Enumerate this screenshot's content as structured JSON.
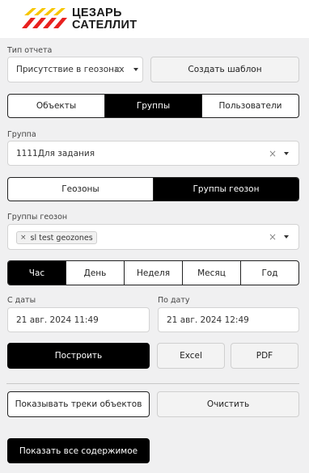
{
  "header": {
    "logo_line1": "ЦЕЗАРЬ",
    "logo_line2": "САТЕЛЛИТ"
  },
  "report_type": {
    "label": "Тип отчета",
    "value": "Присутствие в геозонах",
    "create_template_label": "Создать шаблон"
  },
  "entity_tabs": [
    "Объекты",
    "Группы",
    "Пользователи"
  ],
  "group": {
    "label": "Группа",
    "value": "1111Для задания"
  },
  "zone_tabs": [
    "Геозоны",
    "Группы геозон"
  ],
  "geozone_groups": {
    "label": "Группы геозон",
    "chip": "sl test geozones"
  },
  "period_tabs": [
    "Час",
    "День",
    "Неделя",
    "Месяц",
    "Год"
  ],
  "date_from": {
    "label": "С даты",
    "value": "21 авг. 2024 11:49"
  },
  "date_to": {
    "label": "По дату",
    "value": "21 авг. 2024 12:49"
  },
  "actions": {
    "build": "Построить",
    "excel": "Excel",
    "pdf": "PDF",
    "show_tracks": "Показывать треки объектов",
    "clear": "Очистить",
    "show_all": "Показать все содержимое"
  },
  "colors": {
    "logo_yellow": "#f7c600",
    "logo_red": "#e8211f",
    "active_tab": "#000000"
  },
  "icons": {
    "clear": "close-icon",
    "dropdown": "chevron-down-icon",
    "chip_remove": "close-icon"
  }
}
